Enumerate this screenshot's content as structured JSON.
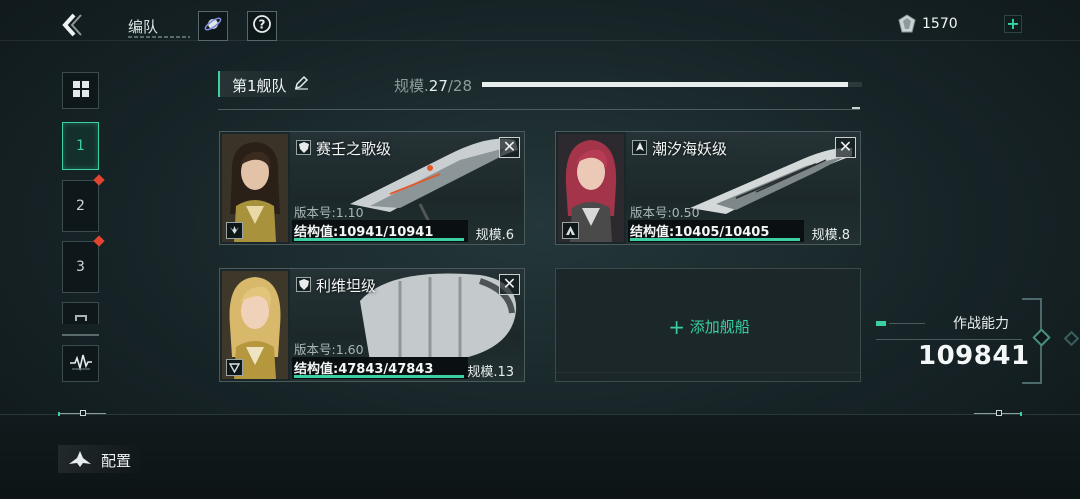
{
  "header": {
    "title": "编队",
    "currency_amount": "1570"
  },
  "sidebar": {
    "slots": [
      {
        "label": "1",
        "active": true
      },
      {
        "label": "2",
        "has_alert": true
      },
      {
        "label": "3",
        "has_alert": true
      }
    ]
  },
  "fleet": {
    "name": "第1舰队",
    "scale_label": "规模.",
    "scale_current": "27",
    "scale_max": "/28",
    "scale_fraction": 0.964
  },
  "ships": [
    {
      "name": "赛壬之歌级",
      "version": "版本号:1.10",
      "structure": "结构值:10941/10941",
      "structure_fraction": 1.0,
      "scale": "规模.6"
    },
    {
      "name": "潮汐海妖级",
      "version": "版本号:0.50",
      "structure": "结构值:10405/10405",
      "structure_fraction": 1.0,
      "scale": "规模.8"
    },
    {
      "name": "利维坦级",
      "version": "版本号:1.60",
      "structure": "结构值:47843/47843",
      "structure_fraction": 1.0,
      "scale": "规模.13"
    }
  ],
  "add_ship_label": "添加舰船",
  "combat": {
    "title": "作战能力",
    "value": "109841"
  },
  "footer": {
    "config_label": "配置"
  },
  "colors": {
    "accent": "#3ad0a4",
    "alert": "#e2452f"
  },
  "icons": [
    "back-arrow-icon",
    "planet-icon",
    "help-icon",
    "gem-icon",
    "plus-icon",
    "grid-icon",
    "pulse-icon",
    "edit-icon",
    "close-icon",
    "shield-icon",
    "ship-icon"
  ]
}
